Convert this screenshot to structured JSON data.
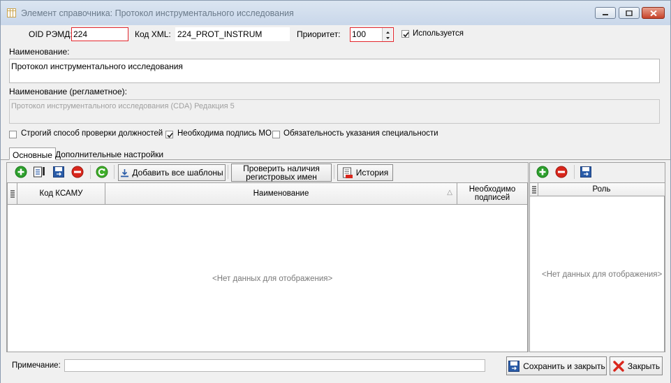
{
  "window": {
    "title": "Элемент справочника: Протокол инструментального исследования",
    "icon": "table-icon"
  },
  "header": {
    "oid_label": "OID РЭМД:",
    "oid_value": "224",
    "xml_label": "Код XML:",
    "xml_value": "224_PROT_INSTRUM",
    "priority_label": "Приоритет:",
    "priority_value": "100",
    "used_label": "Используется",
    "used_checked": true
  },
  "name": {
    "label": "Наименование:",
    "value": "Протокол инструментального исследования"
  },
  "reg_name": {
    "label": "Наименование (регламетное):",
    "value": "Протокол инструментального исследования (CDA) Редакция 5"
  },
  "options": {
    "strict_label": "Строгий способ проверки должностей",
    "strict_checked": false,
    "mo_sign_label": "Необходима подпись МО",
    "mo_sign_checked": true,
    "specialty_label": "Обязательность указания специальности",
    "specialty_checked": false
  },
  "tabs": [
    {
      "label": "Основные",
      "active": true
    },
    {
      "label": "Дополнительные настройки",
      "active": false
    }
  ],
  "left_toolbar": {
    "add_all_templates": "Добавить все шаблоны",
    "check_names_line1": "Проверить наличия",
    "check_names_line2": "регистровых имен",
    "history": "История"
  },
  "left_grid": {
    "columns": [
      "Код КСАМУ",
      "Наименование",
      "Необходимо подписей"
    ],
    "col3_line1": "Необходимо",
    "col3_line2": "подписей",
    "sort_indicator": "△",
    "empty_text": "<Нет данных для отображения>"
  },
  "right_grid": {
    "columns": [
      "Роль"
    ],
    "empty_text": "<Нет данных для отображения>"
  },
  "footer": {
    "note_label": "Примечание:",
    "note_value": "",
    "save_close": "Сохранить и закрыть",
    "close": "Закрыть"
  },
  "colors": {
    "required_border": "#e3272d",
    "add_green": "#2ea02e",
    "delete_red": "#d9261c"
  }
}
